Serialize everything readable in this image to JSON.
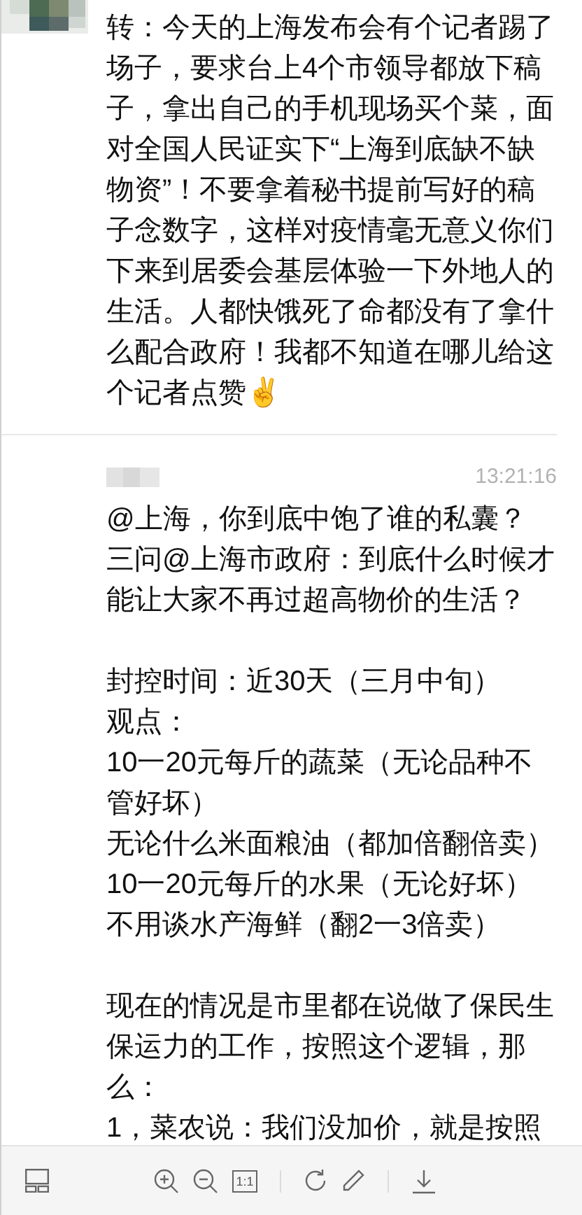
{
  "messages": [
    {
      "kind": "forwarded",
      "sections": [
        [
          "转：今天的上海发布会有个记者踢了场子，要求台上4个市领导都放下稿子，拿出自己的手机现场买个菜，面对全国人民证实下“上海到底缺不缺物资”！不要拿着秘书提前写好的稿子念数字，这样对疫情毫无意义你们下来到居委会基层体验一下外地人的生活。人都快饿死了命都没有了拿什么配合政府！我都不知道在哪儿给这个记者点赞✌"
        ]
      ]
    },
    {
      "kind": "post",
      "time": "13:21:16",
      "sections": [
        [
          "@上海，你到底中饱了谁的私囊？",
          "三问@上海市政府：到底什么时候才能让大家不再过超高物价的生活？"
        ],
        [
          "封控时间：近30天（三月中旬）",
          "观点：",
          "10一20元每斤的蔬菜（无论品种不管好坏）",
          "无论什么米面粮油（都加倍翻倍卖）",
          "10一20元每斤的水果（无论好坏）",
          "不用谈水产海鲜（翻2一3倍卖）"
        ],
        [
          "现在的情况是市里都在说做了保民生保运力的工作，按照这个逻辑，那么：",
          "1，菜农说：我们没加价，就是按照"
        ]
      ]
    }
  ],
  "toolbar": [
    {
      "kind": "thumbnails"
    },
    {
      "kind": "zoom-in"
    },
    {
      "kind": "zoom-out"
    },
    {
      "kind": "actual-size",
      "label": "1:1"
    },
    {
      "kind": "divider"
    },
    {
      "kind": "rotate"
    },
    {
      "kind": "edit"
    },
    {
      "kind": "divider"
    },
    {
      "kind": "download"
    }
  ]
}
